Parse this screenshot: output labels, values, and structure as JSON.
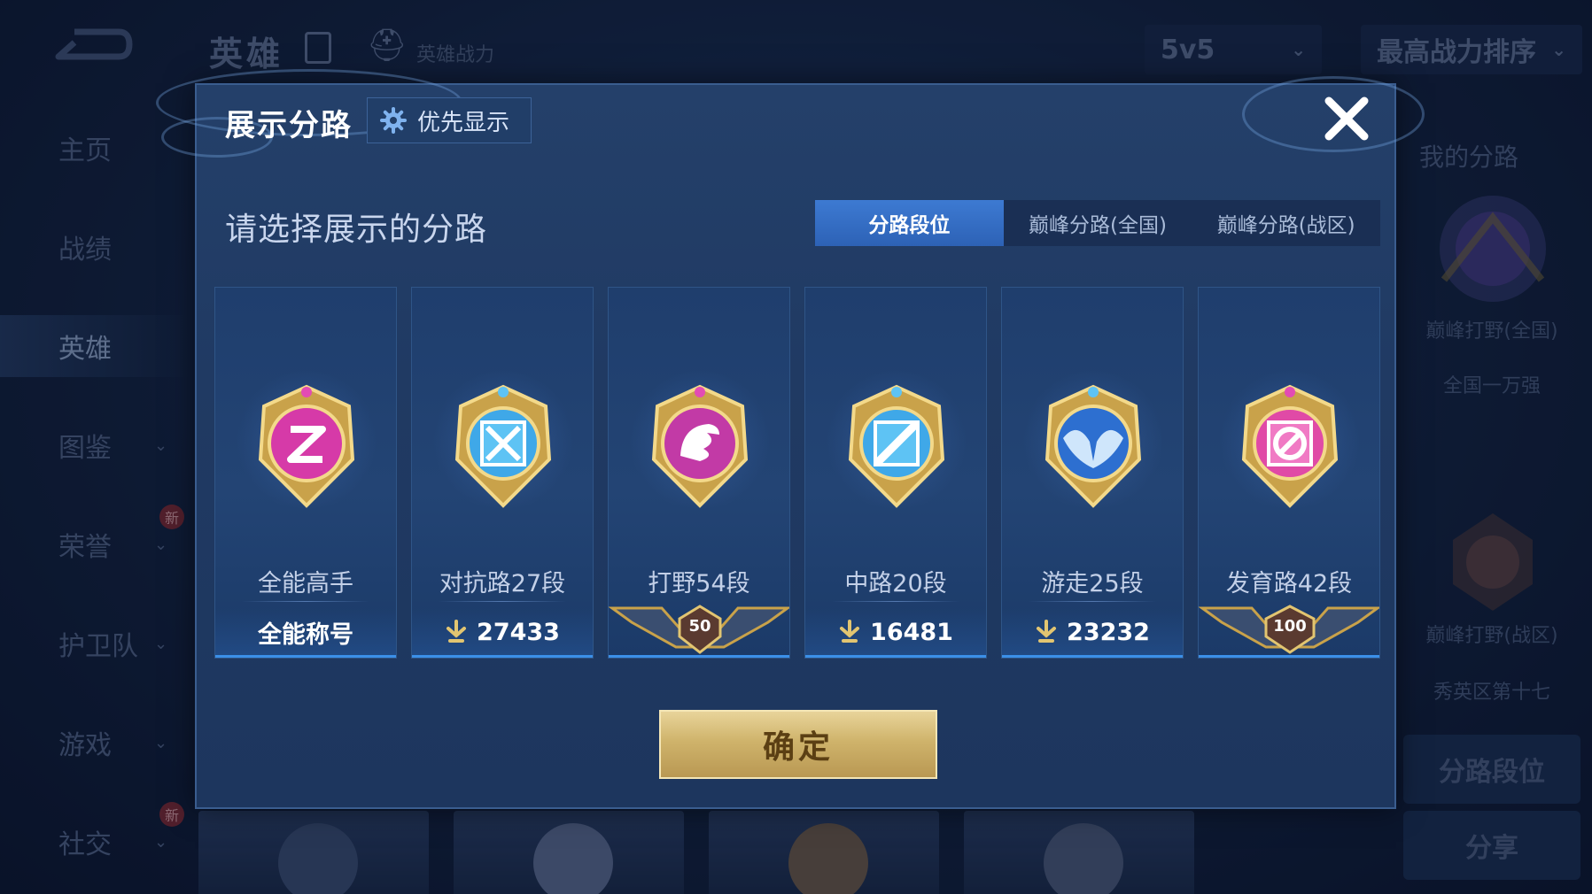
{
  "background": {
    "top_title": "英雄",
    "power_label": "英雄战力",
    "dropdown_mode": "5v5",
    "dropdown_sort": "最高战力排序",
    "sidebar": [
      {
        "label": "主页"
      },
      {
        "label": "战绩"
      },
      {
        "label": "英雄"
      },
      {
        "label": "图鉴"
      },
      {
        "label": "荣誉"
      },
      {
        "label": "护卫队"
      },
      {
        "label": "游戏"
      },
      {
        "label": "社交"
      }
    ],
    "new_badge": "新",
    "right_panel": {
      "title": "我的分路",
      "peak_national": "巅峰打野(全国)",
      "peak_national_rank": "全国一万强",
      "peak_zone": "巅峰打野(战区)",
      "peak_zone_rank": "秀英区第十七",
      "lane_rank_button": "分路段位",
      "share_button": "分享"
    }
  },
  "modal": {
    "title": "展示分路",
    "priority_button": "优先显示",
    "subtitle": "请选择展示的分路",
    "tabs": [
      "分路段位",
      "巅峰分路(全国)",
      "巅峰分路(战区)"
    ],
    "active_tab": 0,
    "cards": [
      {
        "name": "全能高手",
        "footer": "全能称号",
        "emblem_color": "#d63aa8"
      },
      {
        "name": "对抗路27段",
        "footer": "27433",
        "emblem_color": "#3fa8e8"
      },
      {
        "name": "打野54段",
        "footer": "50",
        "emblem_color": "#c23aa6"
      },
      {
        "name": "中路20段",
        "footer": "16481",
        "emblem_color": "#3fa8e8"
      },
      {
        "name": "游走25段",
        "footer": "23232",
        "emblem_color": "#2d6fd0"
      },
      {
        "name": "发育路42段",
        "footer": "100",
        "emblem_color": "#e04aa6"
      }
    ],
    "confirm": "确定"
  },
  "colors": {
    "accent_blue": "#2d62b6",
    "gold": "#cfb36b"
  }
}
